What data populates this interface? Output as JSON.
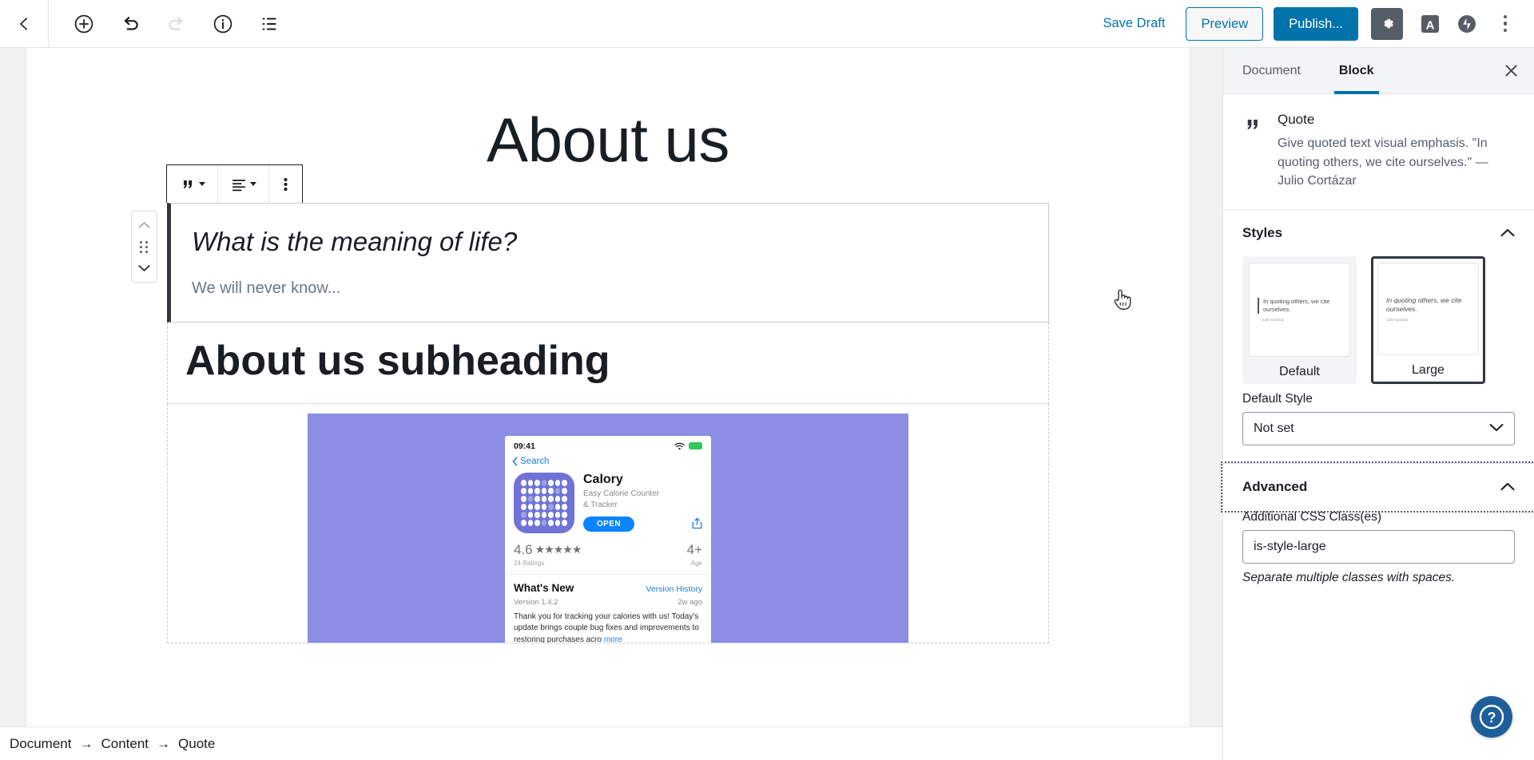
{
  "header": {
    "back_icon": "chevron-left-icon",
    "tools": [
      {
        "name": "add-block-icon",
        "label": "Add block",
        "disabled": false
      },
      {
        "name": "undo-icon",
        "label": "Undo",
        "disabled": false
      },
      {
        "name": "redo-icon",
        "label": "Redo",
        "disabled": true
      },
      {
        "name": "info-icon",
        "label": "Content structure",
        "disabled": false
      },
      {
        "name": "block-navigation-icon",
        "label": "Block navigation",
        "disabled": false
      }
    ],
    "save_draft_label": "Save Draft",
    "preview_label": "Preview",
    "publish_label": "Publish...",
    "settings_icon": "gear-icon",
    "jetpack_a_icon": "letter-a-icon",
    "jetpack_icon": "jetpack-bolt-icon",
    "more_icon": "kebab-menu-icon"
  },
  "editor": {
    "post_title": "About us",
    "block_toolbar": {
      "block_type_icon": "quote-icon",
      "align_icon": "align-text-icon",
      "more_icon": "vertical-dots-icon"
    },
    "mover": {
      "up_icon": "chevron-up-icon",
      "drag_icon": "drag-handle-icon",
      "down_icon": "chevron-down-icon"
    },
    "quote": {
      "text": "What is the meaning of life?",
      "citation": "We will never know..."
    },
    "heading": "About us subheading",
    "image_block": {
      "phone": {
        "status_time": "09:41",
        "back_label": "Search",
        "app_name": "Calory",
        "app_subtitle_line1": "Easy Calorie Counter",
        "app_subtitle_line2": "& Tracker",
        "open_label": "OPEN",
        "rating_value": "4.6",
        "stars": "★★★★★",
        "ratings_count": "24 Ratings",
        "age_rating": "4+",
        "age_label": "Age",
        "whats_new_title": "What's New",
        "version_history_label": "Version History",
        "version": "Version 1.4.2",
        "version_ago": "2w ago",
        "release_notes": "Thank you for tracking your calories with us! Today's update brings couple bug fixes and improvements to restoring purchases acro",
        "more_label": "more"
      }
    }
  },
  "sidebar": {
    "tabs": [
      {
        "label": "Document",
        "active": false
      },
      {
        "label": "Block",
        "active": true
      }
    ],
    "close_icon": "close-icon",
    "block_card": {
      "icon": "quote-icon",
      "title": "Quote",
      "description": "Give quoted text visual emphasis. \"In quoting others, we cite ourselves.\" — Julio Cortázar"
    },
    "styles_panel": {
      "title": "Styles",
      "toggle_icon": "chevron-up-icon",
      "options": [
        {
          "label": "Default",
          "selected": false,
          "hovered": true,
          "preview_quote": "In quoting others, we cite ourselves.",
          "preview_cite": "Julio Cortázar"
        },
        {
          "label": "Large",
          "selected": true,
          "hovered": false,
          "preview_quote": "In quoting others, we cite ourselves.",
          "preview_cite": "Julio Cortázar"
        }
      ],
      "default_style_label": "Default Style",
      "default_style_value": "Not set",
      "select_chevron_icon": "chevron-down-icon"
    },
    "advanced_panel": {
      "title": "Advanced",
      "toggle_icon": "chevron-up-icon",
      "css_class_label": "Additional CSS Class(es)",
      "css_class_value": "is-style-large",
      "css_class_help": "Separate multiple classes with spaces."
    }
  },
  "breadcrumb": {
    "items": [
      "Document",
      "Content",
      "Quote"
    ],
    "separator": "→"
  },
  "help_button": {
    "icon": "question-mark-icon",
    "label": "Help"
  },
  "colors": {
    "accent_blue": "#0073aa",
    "dark_gray": "#555d66",
    "text": "#191e23",
    "muted": "#6c7781",
    "panel_bg": "#f3f4f5",
    "image_bg": "#8b8ee4",
    "help_blue": "#1c5f99"
  }
}
